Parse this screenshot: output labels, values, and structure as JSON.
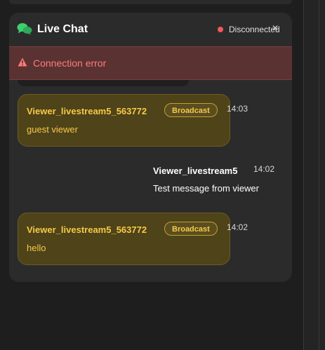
{
  "header": {
    "title": "Live Chat",
    "status_text": "Disconnected",
    "close_icon": "×"
  },
  "error": {
    "message": "Connection error"
  },
  "messages": [
    {
      "sender": "Viewer_livestream5_563772",
      "badge": "Broadcast",
      "time": "14:03",
      "text": "guest viewer"
    },
    {
      "sender": "Viewer_livestream5",
      "time": "14:02",
      "text": "Test message from viewer"
    },
    {
      "sender": "Viewer_livestream5_563772",
      "badge": "Broadcast",
      "time": "14:02",
      "text": "hello"
    }
  ],
  "colors": {
    "accent_green": "#3ecf6e",
    "status_red": "#f05a5a",
    "broadcast_gold": "#f7c948",
    "error_text": "#ff7b7b"
  }
}
